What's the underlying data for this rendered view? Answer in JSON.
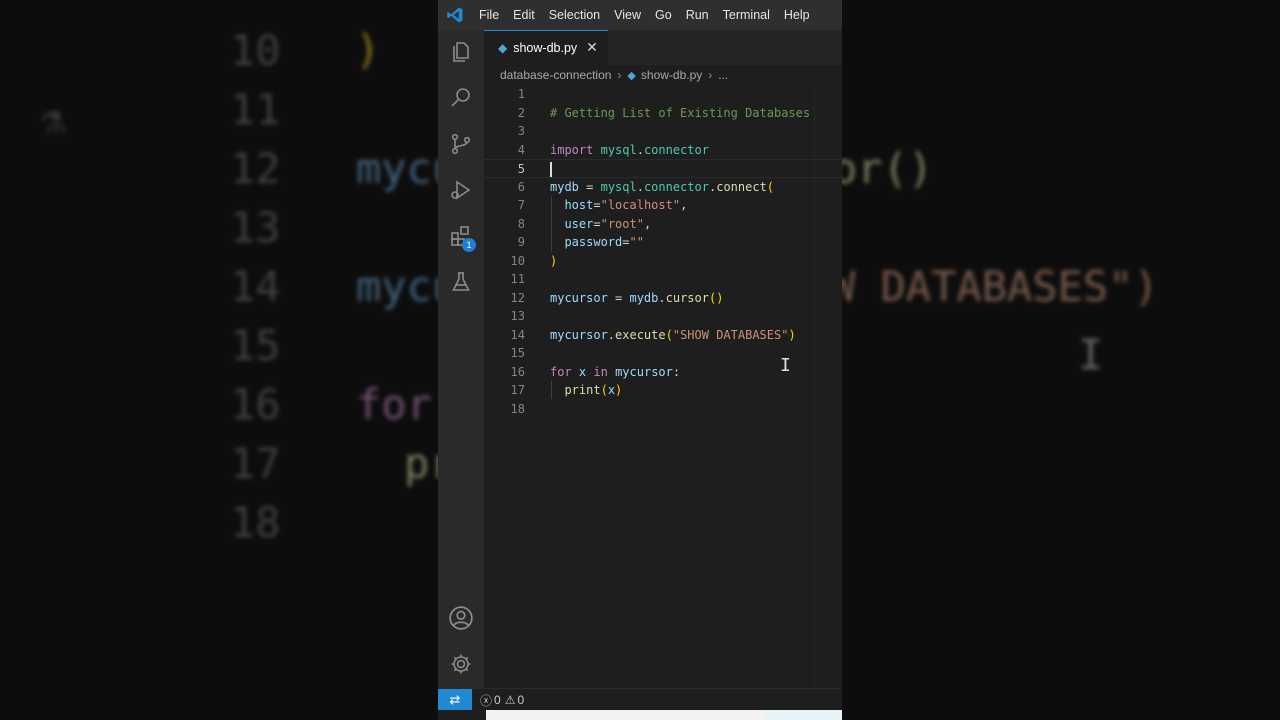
{
  "background": {
    "left_lines": [
      "10",
      "11",
      "12",
      "13",
      "14",
      "15",
      "16",
      "17",
      "18"
    ],
    "left_fragments": [
      "mycu",
      "mycu",
      "for",
      "pr"
    ],
    "right_fragments": [
      "or()",
      "W DATABASES\")"
    ]
  },
  "titlebar": {
    "menu": [
      "File",
      "Edit",
      "Selection",
      "View",
      "Go",
      "Run",
      "Terminal",
      "Help"
    ]
  },
  "activity_bar": {
    "extensions_badge": "1"
  },
  "tab": {
    "filename": "show-db.py",
    "close": "✕"
  },
  "breadcrumb": {
    "folder": "database-connection",
    "file": "show-db.py",
    "more": "..."
  },
  "editor": {
    "active_line": 5,
    "lines": [
      {
        "n": "1"
      },
      {
        "n": "2",
        "parts": [
          [
            "# Getting List of Existing Databases",
            "com"
          ]
        ]
      },
      {
        "n": "3"
      },
      {
        "n": "4",
        "parts": [
          [
            "import",
            "kw"
          ],
          [
            " ",
            "op"
          ],
          [
            "mysql",
            "mod"
          ],
          [
            ".",
            "op"
          ],
          [
            "connector",
            "mod"
          ]
        ]
      },
      {
        "n": "5"
      },
      {
        "n": "6",
        "parts": [
          [
            "mydb",
            "var"
          ],
          [
            " = ",
            "op"
          ],
          [
            "mysql",
            "mod"
          ],
          [
            ".",
            "op"
          ],
          [
            "connector",
            "mod"
          ],
          [
            ".",
            "op"
          ],
          [
            "connect",
            "fn"
          ],
          [
            "(",
            "p1"
          ]
        ]
      },
      {
        "n": "7",
        "parts": [
          [
            "  ",
            "op"
          ],
          [
            "host",
            "var"
          ],
          [
            "=",
            "op"
          ],
          [
            "\"localhost\"",
            "str"
          ],
          [
            ",",
            "op"
          ]
        ]
      },
      {
        "n": "8",
        "parts": [
          [
            "  ",
            "op"
          ],
          [
            "user",
            "var"
          ],
          [
            "=",
            "op"
          ],
          [
            "\"root\"",
            "str"
          ],
          [
            ",",
            "op"
          ]
        ]
      },
      {
        "n": "9",
        "parts": [
          [
            "  ",
            "op"
          ],
          [
            "password",
            "var"
          ],
          [
            "=",
            "op"
          ],
          [
            "\"\"",
            "str"
          ]
        ]
      },
      {
        "n": "10",
        "parts": [
          [
            ")",
            "p1"
          ]
        ]
      },
      {
        "n": "11"
      },
      {
        "n": "12",
        "parts": [
          [
            "mycursor",
            "var"
          ],
          [
            " = ",
            "op"
          ],
          [
            "mydb",
            "var"
          ],
          [
            ".",
            "op"
          ],
          [
            "cursor",
            "fn"
          ],
          [
            "()",
            "p1"
          ]
        ]
      },
      {
        "n": "13"
      },
      {
        "n": "14",
        "parts": [
          [
            "mycursor",
            "var"
          ],
          [
            ".",
            "op"
          ],
          [
            "execute",
            "fn"
          ],
          [
            "(",
            "p1"
          ],
          [
            "\"SHOW DATABASES\"",
            "str"
          ],
          [
            ")",
            "p1"
          ]
        ]
      },
      {
        "n": "15"
      },
      {
        "n": "16",
        "parts": [
          [
            "for",
            "kw"
          ],
          [
            " ",
            "op"
          ],
          [
            "x",
            "var"
          ],
          [
            " ",
            "op"
          ],
          [
            "in",
            "kw"
          ],
          [
            " ",
            "op"
          ],
          [
            "mycursor",
            "var"
          ],
          [
            ":",
            "op"
          ]
        ]
      },
      {
        "n": "17",
        "parts": [
          [
            "  ",
            "op"
          ],
          [
            "print",
            "fn"
          ],
          [
            "(",
            "p1"
          ],
          [
            "x",
            "var"
          ],
          [
            ")",
            "p1"
          ]
        ]
      },
      {
        "n": "18"
      }
    ]
  },
  "statusbar": {
    "errors": "0",
    "warnings": "0"
  },
  "colors": {
    "accent": "#1f8ad2",
    "comment": "#6a9955",
    "keyword": "#c586c0",
    "module": "#4ec9b0",
    "variable": "#9cdcfe",
    "function": "#dcdcaa",
    "string": "#ce9178",
    "bracket": "#ffd700"
  }
}
